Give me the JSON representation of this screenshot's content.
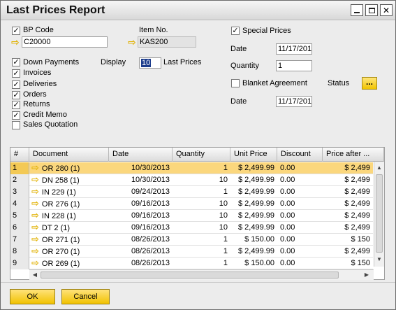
{
  "window": {
    "title": "Last Prices Report",
    "controls": [
      "minimize",
      "maximize",
      "close"
    ]
  },
  "left": {
    "bp_code_label": "BP Code",
    "bp_code_checked": true,
    "bp_code_value": "C20000",
    "item_no_label": "Item No.",
    "item_no_value": "KAS200",
    "doc_types": [
      {
        "label": "Down Payments",
        "checked": true
      },
      {
        "label": "Invoices",
        "checked": true
      },
      {
        "label": "Deliveries",
        "checked": true
      },
      {
        "label": "Orders",
        "checked": true
      },
      {
        "label": "Returns",
        "checked": true
      },
      {
        "label": "Credit Memo",
        "checked": true
      },
      {
        "label": "Sales Quotation",
        "checked": false
      }
    ],
    "display_label": "Display",
    "display_value": "10",
    "last_prices_label": "Last Prices"
  },
  "right": {
    "special_prices_label": "Special Prices",
    "special_prices_checked": true,
    "date_label": "Date",
    "date_value": "11/17/201",
    "quantity_label": "Quantity",
    "quantity_value": "1",
    "blanket_agreement_label": "Blanket Agreement",
    "blanket_agreement_checked": false,
    "status_label": "Status",
    "status_button": "...",
    "date2_label": "Date",
    "date2_value": "11/17/201"
  },
  "grid": {
    "headers": [
      "#",
      "Document",
      "Date",
      "Quantity",
      "Unit Price",
      "Discount",
      "Price after ..."
    ],
    "rows": [
      {
        "n": "1",
        "doc": "OR 280 (1)",
        "date": "10/30/2013",
        "qty": "1",
        "unit": "$ 2,499.99",
        "disc": "0.00",
        "after": "$ 2,499",
        "selected": true
      },
      {
        "n": "2",
        "doc": "DN 258 (1)",
        "date": "10/30/2013",
        "qty": "10",
        "unit": "$ 2,499.99",
        "disc": "0.00",
        "after": "$ 2,499",
        "selected": false
      },
      {
        "n": "3",
        "doc": "IN 229 (1)",
        "date": "09/24/2013",
        "qty": "1",
        "unit": "$ 2,499.99",
        "disc": "0.00",
        "after": "$ 2,499",
        "selected": false
      },
      {
        "n": "4",
        "doc": "OR 276 (1)",
        "date": "09/16/2013",
        "qty": "10",
        "unit": "$ 2,499.99",
        "disc": "0.00",
        "after": "$ 2,499",
        "selected": false
      },
      {
        "n": "5",
        "doc": "IN 228 (1)",
        "date": "09/16/2013",
        "qty": "10",
        "unit": "$ 2,499.99",
        "disc": "0.00",
        "after": "$ 2,499",
        "selected": false
      },
      {
        "n": "6",
        "doc": "DT 2 (1)",
        "date": "09/16/2013",
        "qty": "10",
        "unit": "$ 2,499.99",
        "disc": "0.00",
        "after": "$ 2,499",
        "selected": false
      },
      {
        "n": "7",
        "doc": "OR 271 (1)",
        "date": "08/26/2013",
        "qty": "1",
        "unit": "$ 150.00",
        "disc": "0.00",
        "after": "$ 150",
        "selected": false
      },
      {
        "n": "8",
        "doc": "OR 270 (1)",
        "date": "08/26/2013",
        "qty": "1",
        "unit": "$ 2,499.99",
        "disc": "0.00",
        "after": "$ 2,499",
        "selected": false
      },
      {
        "n": "9",
        "doc": "OR 269 (1)",
        "date": "08/26/2013",
        "qty": "1",
        "unit": "$ 150.00",
        "disc": "0.00",
        "after": "$ 150",
        "selected": false
      }
    ]
  },
  "footer": {
    "ok_label": "OK",
    "cancel_label": "Cancel"
  },
  "colors": {
    "accent": "#f1c400",
    "selected_row": "#fbd77d",
    "link_arrow": "#e1b100"
  }
}
